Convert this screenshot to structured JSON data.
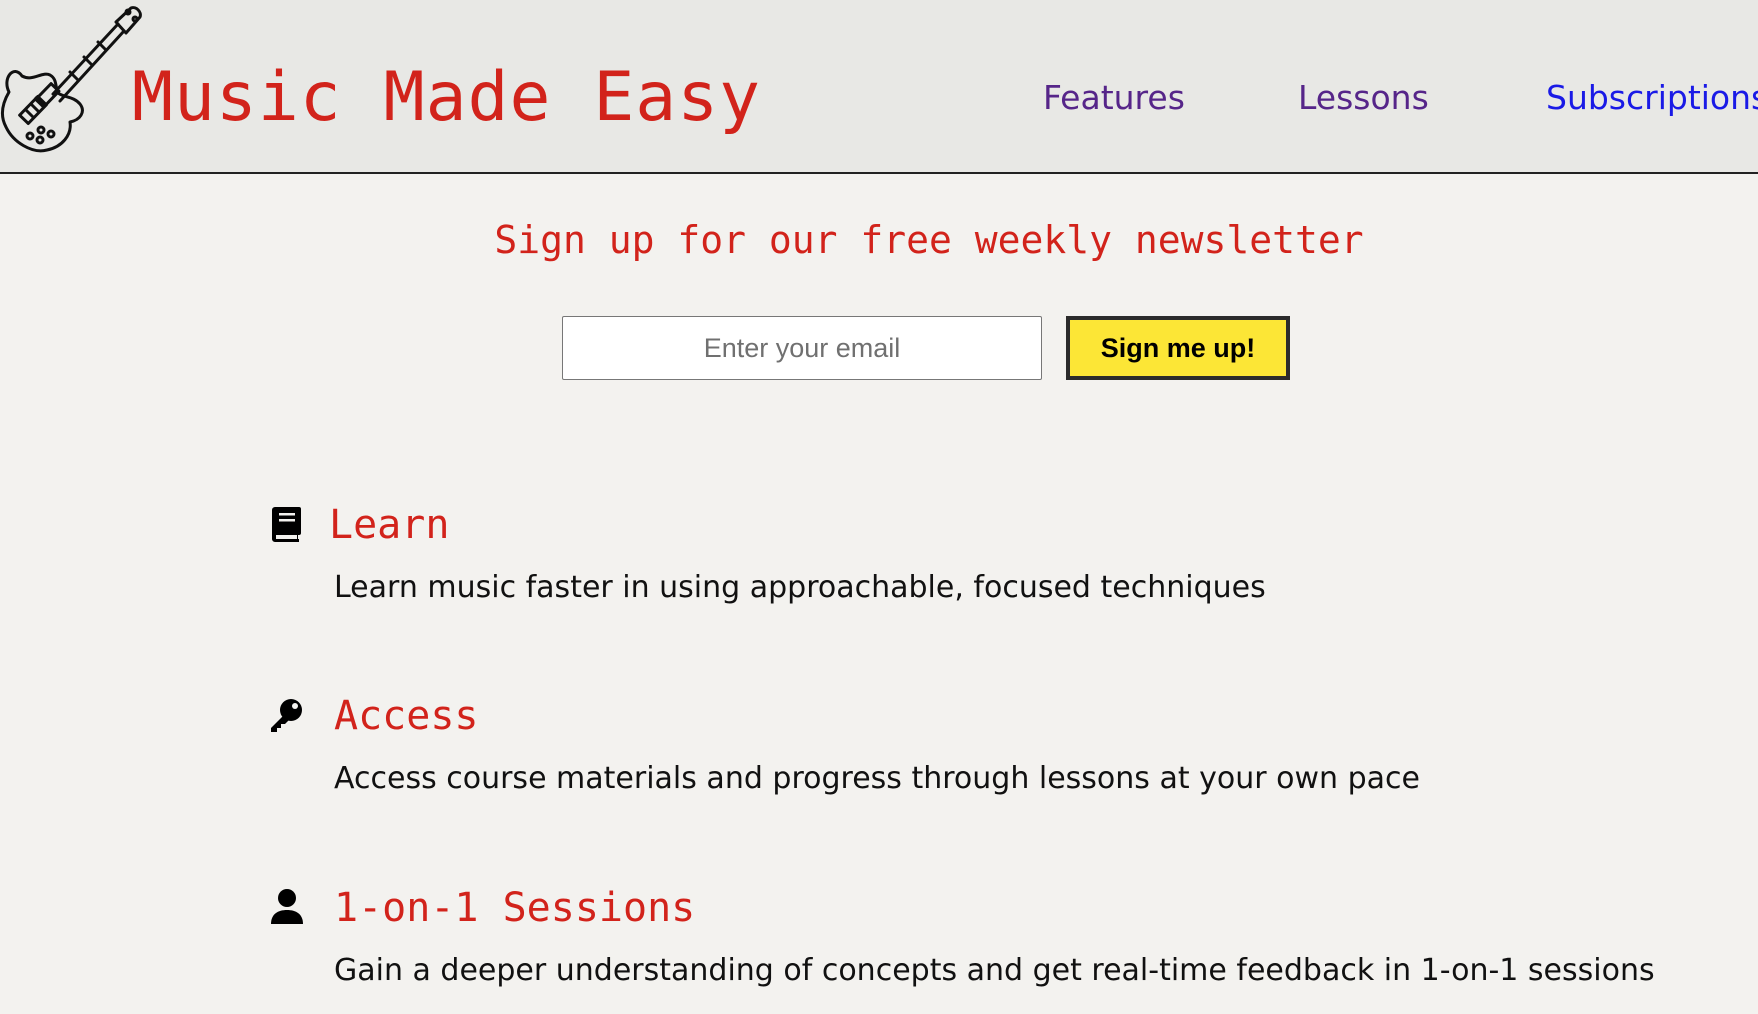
{
  "header": {
    "brand": "Music Made Easy",
    "logo_icon": "electric-guitar-icon",
    "nav": {
      "features": "Features",
      "lessons": "Lessons",
      "subscriptions": "Subscriptions"
    }
  },
  "newsletter": {
    "title": "Sign up for our free weekly newsletter",
    "email_placeholder": "Enter your email",
    "button_label": "Sign me up!"
  },
  "features": [
    {
      "icon": "book-icon",
      "title": "Learn",
      "description": "Learn music faster in using approachable, focused techniques"
    },
    {
      "icon": "key-icon",
      "title": "Access",
      "description": "Access course materials and progress through lessons at your own pace"
    },
    {
      "icon": "user-icon",
      "title": "1-on-1 Sessions",
      "description": "Gain a deeper understanding of concepts and get real-time feedback in 1-on-1 sessions"
    }
  ],
  "colors": {
    "brand_red": "#d2231b",
    "nav_visited": "#562589",
    "nav_link": "#1a1ae6",
    "button_yellow": "#fce636",
    "page_bg": "#f3f2ef",
    "header_bg": "#e8e8e5"
  }
}
